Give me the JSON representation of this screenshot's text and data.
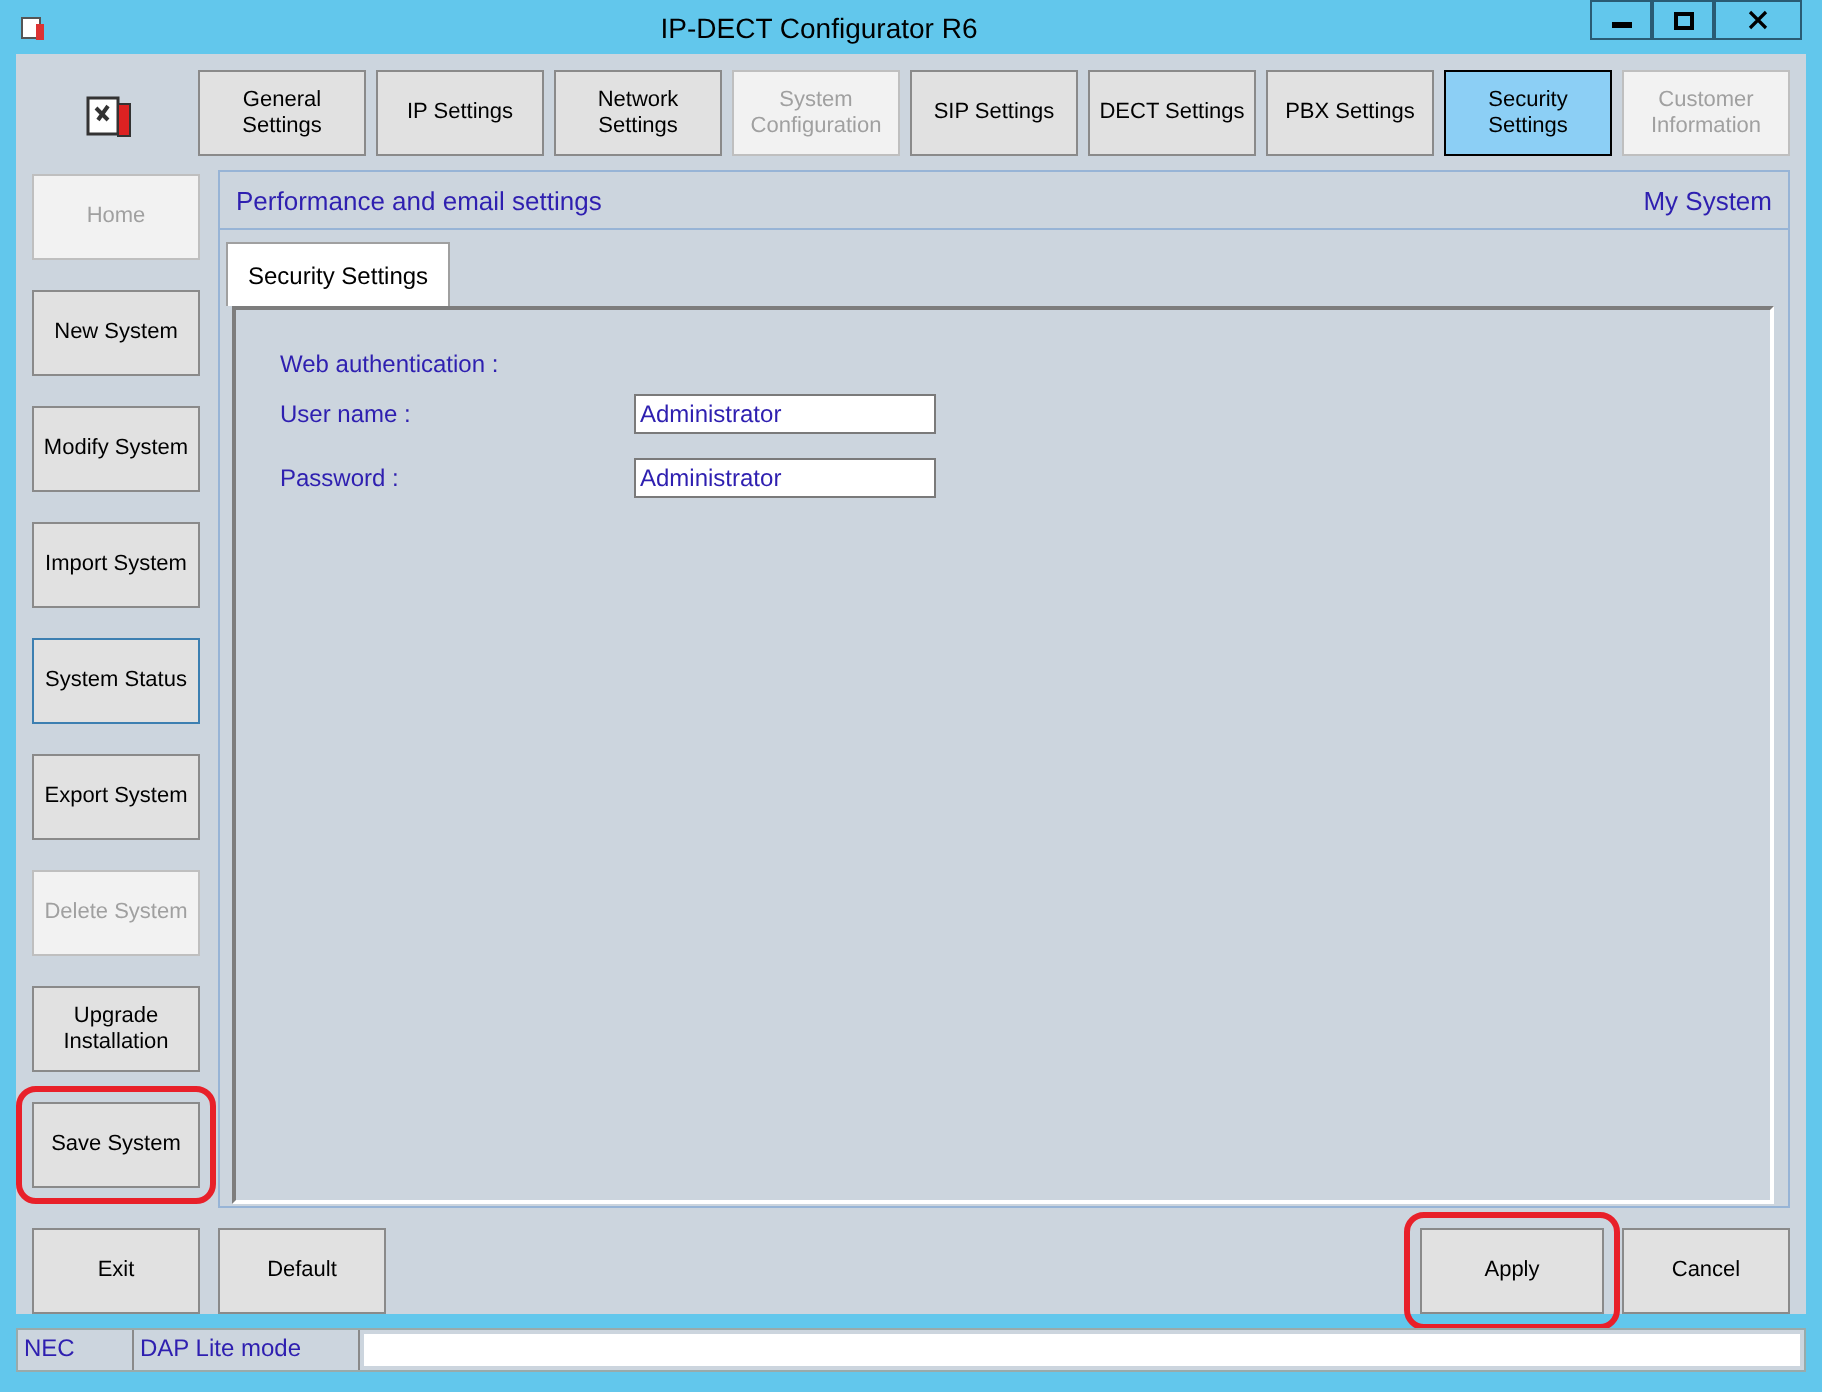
{
  "window": {
    "title": "IP-DECT Configurator R6"
  },
  "tabs": [
    {
      "label": "General Settings",
      "selected": false,
      "disabled": false
    },
    {
      "label": "IP Settings",
      "selected": false,
      "disabled": false
    },
    {
      "label": "Network Settings",
      "selected": false,
      "disabled": false
    },
    {
      "label": "System Configuration",
      "selected": false,
      "disabled": true
    },
    {
      "label": "SIP Settings",
      "selected": false,
      "disabled": false
    },
    {
      "label": "DECT Settings",
      "selected": false,
      "disabled": false
    },
    {
      "label": "PBX Settings",
      "selected": false,
      "disabled": false
    },
    {
      "label": "Security Settings",
      "selected": true,
      "disabled": false
    },
    {
      "label": "Customer Information",
      "selected": false,
      "disabled": true
    }
  ],
  "sidebar": {
    "items": [
      {
        "label": "Home",
        "disabled": true,
        "focused": false,
        "highlighted": false
      },
      {
        "label": "New System",
        "disabled": false,
        "focused": false,
        "highlighted": false
      },
      {
        "label": "Modify System",
        "disabled": false,
        "focused": false,
        "highlighted": false
      },
      {
        "label": "Import System",
        "disabled": false,
        "focused": false,
        "highlighted": false
      },
      {
        "label": "System Status",
        "disabled": false,
        "focused": true,
        "highlighted": false
      },
      {
        "label": "Export System",
        "disabled": false,
        "focused": false,
        "highlighted": false
      },
      {
        "label": "Delete System",
        "disabled": true,
        "focused": false,
        "highlighted": false
      },
      {
        "label": "Upgrade Installation",
        "disabled": false,
        "focused": false,
        "highlighted": false
      },
      {
        "label": "Save System",
        "disabled": false,
        "focused": false,
        "highlighted": true
      }
    ]
  },
  "panel": {
    "heading": "Performance and email settings",
    "system_name": "My System",
    "subtabs": [
      {
        "label": "Security Settings",
        "selected": true
      }
    ],
    "section_label": "Web authentication :",
    "fields": [
      {
        "label": "User name :",
        "value": "Administrator"
      },
      {
        "label": "Password :",
        "value": "Administrator"
      }
    ]
  },
  "footer": {
    "left_buttons": [
      {
        "label": "Exit",
        "highlighted": false
      },
      {
        "label": "Default",
        "highlighted": false
      }
    ],
    "right_buttons": [
      {
        "label": "Apply",
        "highlighted": true
      },
      {
        "label": "Cancel",
        "highlighted": false
      }
    ]
  },
  "status_bar": [
    "NEC",
    "DAP Lite mode"
  ]
}
